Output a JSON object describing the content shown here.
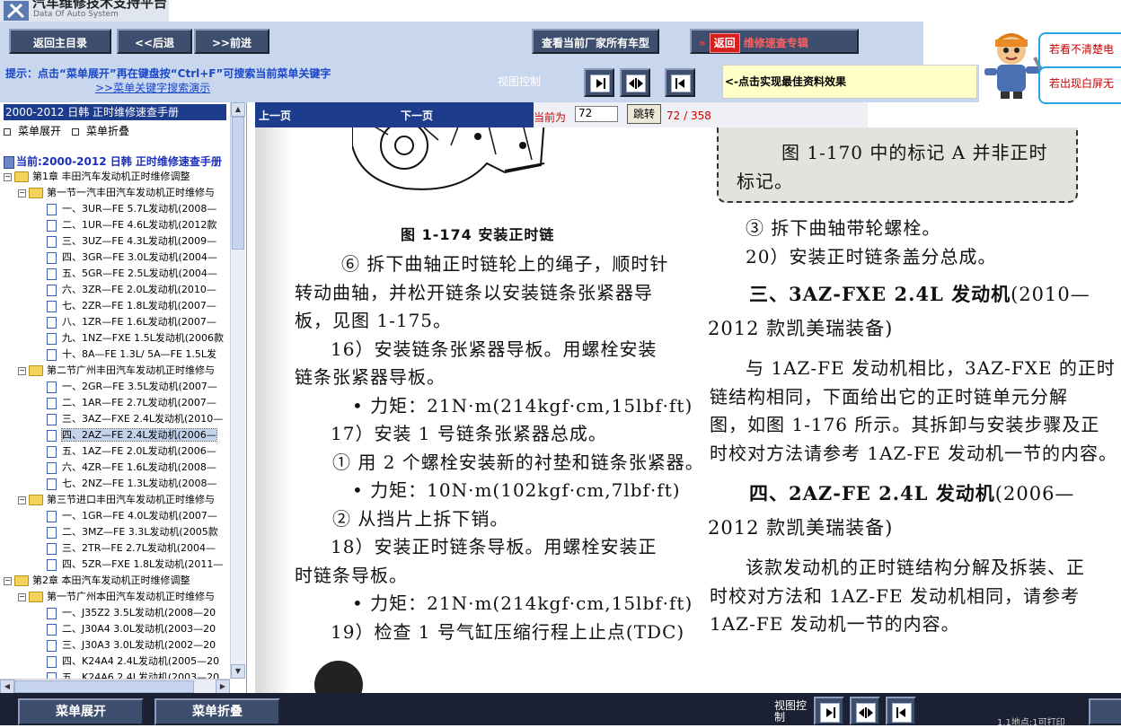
{
  "app": {
    "title": "汽车维修技术支持平台",
    "subtitle": "Data Of Auto System"
  },
  "toolbar": {
    "home": "返回主目录",
    "back": "<<后退",
    "forward": ">>前进",
    "models": "查看当前厂家所有车型",
    "return_tag": "返回",
    "return_label": "维修速查专辑"
  },
  "help": {
    "line1": "若看不清楚电",
    "line2": "若出现白屏无"
  },
  "hint": {
    "text": "提示：点击“菜单展开”再在键盘按“Ctrl+F”可搜索当前菜单关键字",
    "link": ">>菜单关键字搜索演示"
  },
  "view_control": {
    "label": "视图控制",
    "tip": "<-点击实现最佳资料效果"
  },
  "sidebar": {
    "header": "2000-2012 日韩  正时维修速查手册",
    "expand": "菜单展开",
    "collapse": "菜单折叠",
    "current": "当前:2000-2012 日韩  正时维修速查手册",
    "tree": [
      {
        "label": "第1章  丰田汽车发动机正时维修调整",
        "type": "folder"
      },
      {
        "label": "第一节一汽丰田汽车发动机正时维修与",
        "type": "folder"
      },
      {
        "label": "一、3UR—FE 5.7L发动机(2008—",
        "type": "doc"
      },
      {
        "label": "二、1UR—FE 4.6L发动机(2012款",
        "type": "doc"
      },
      {
        "label": "三、3UZ—FE 4.3L发动机(2009—",
        "type": "doc"
      },
      {
        "label": "四、3GR—FE 3.0L发动机(2004—",
        "type": "doc"
      },
      {
        "label": "五、5GR—FE 2.5L发动机(2004—",
        "type": "doc"
      },
      {
        "label": "六、3ZR—FE 2.0L发动机(2010—",
        "type": "doc"
      },
      {
        "label": "七、2ZR—FE 1.8L发动机(2007—",
        "type": "doc"
      },
      {
        "label": "八、1ZR—FE 1.6L发动机(2007—",
        "type": "doc"
      },
      {
        "label": "九、1NZ—FXE 1.5L发动机(2006款",
        "type": "doc"
      },
      {
        "label": "十、8A—FE 1.3L/ 5A—FE 1.5L发",
        "type": "doc"
      },
      {
        "label": "第二节广州丰田汽车发动机正时维修与",
        "type": "folder"
      },
      {
        "label": "一、2GR—FE 3.5L发动机(2007—",
        "type": "doc"
      },
      {
        "label": "二、1AR—FE 2.7L发动机(2007—",
        "type": "doc"
      },
      {
        "label": "三、3AZ—FXE 2.4L发动机(2010—",
        "type": "doc"
      },
      {
        "label": "四、2AZ—FE 2.4L发动机(2006—",
        "type": "doc",
        "selected": true
      },
      {
        "label": "五、1AZ—FE 2.0L发动机(2006—",
        "type": "doc"
      },
      {
        "label": "六、4ZR—FE 1.6L发动机(2008—",
        "type": "doc"
      },
      {
        "label": "七、2NZ—FE 1.3L发动机(2008—",
        "type": "doc"
      },
      {
        "label": "第三节进口丰田汽车发动机正时维修与",
        "type": "folder"
      },
      {
        "label": "一、1GR—FE 4.0L发动机(2007—",
        "type": "doc"
      },
      {
        "label": "二、3MZ—FE 3.3L发动机(2005款",
        "type": "doc"
      },
      {
        "label": "三、2TR—FE 2.7L发动机(2004—",
        "type": "doc"
      },
      {
        "label": "四、5ZR—FXE 1.8L发动机(2011—",
        "type": "doc"
      },
      {
        "label": "第2章  本田汽车发动机正时维修调整",
        "type": "folder"
      },
      {
        "label": "第一节广州本田汽车发动机正时维修与",
        "type": "folder"
      },
      {
        "label": "一、J35Z2 3.5L发动机(2008—20",
        "type": "doc"
      },
      {
        "label": "二、J30A4 3.0L发动机(2003—20",
        "type": "doc"
      },
      {
        "label": "三、J30A3 3.0L发动机(2002—20",
        "type": "doc"
      },
      {
        "label": "四、K24A4 2.4L发动机(2005—20",
        "type": "doc"
      },
      {
        "label": "五、K24A6 2.4L发动机(2003—20",
        "type": "doc"
      }
    ]
  },
  "doc_nav": {
    "prev": "上一页",
    "next": "下一页",
    "current_label": "当前为",
    "page": "72",
    "jump": "跳转",
    "count": "72 / 358"
  },
  "document": {
    "note": "图 1-170 中的标记 A 并非正时",
    "note2": "标记。",
    "fig_caption": "图 1-174    安装正时链",
    "left": [
      "⑥ 拆下曲轴正时链轮上的绳子，顺时针",
      "转动曲轴，并松开链条以安装链条张紧器导",
      "板，见图 1-175。",
      "16）安装链条张紧器导板。用螺栓安装",
      "链条张紧器导板。",
      "• 力矩：21N·m(214kgf·cm,15lbf·ft)",
      "17）安装 1 号链条张紧器总成。",
      "① 用 2 个螺栓安装新的衬垫和链条张紧器。",
      "• 力矩：10N·m(102kgf·cm,7lbf·ft)",
      "② 从挡片上拆下销。",
      "18）安装正时链条导板。用螺栓安装正",
      "时链条导板。",
      "• 力矩：21N·m(214kgf·cm,15lbf·ft)",
      "19）检查 1 号气缸压缩行程上止点(TDC)"
    ],
    "right_top": [
      "③ 拆下曲轴带轮螺栓。",
      "20）安装正时链条盖分总成。"
    ],
    "h1_bold": "三、3AZ-FXE 2.4L 发动机",
    "h1_rest": "(2010—",
    "h1_line2": "2012 款凯美瑞装备)",
    "para1": [
      "与 1AZ-FE 发动机相比，3AZ-FXE 的正时",
      "链结构相同，下面给出它的正时链单元分解",
      "图，如图 1-176 所示。其拆卸与安装步骤及正",
      "时校对方法请参考 1AZ-FE 发动机一节的内容。"
    ],
    "h2_bold": "四、2AZ-FE 2.4L 发动机",
    "h2_rest": "(2006—",
    "h2_line2": "2012 款凯美瑞装备)",
    "para2": [
      "该款发动机的正时链结构分解及拆装、正",
      "时校对方法和 1AZ-FE 发动机相同，请参考",
      "1AZ-FE 发动机一节的内容。"
    ]
  },
  "bottom": {
    "expand": "菜单展开",
    "collapse": "菜单折叠",
    "view_label": "视图控制",
    "status": "1.1地点:1可打印"
  }
}
